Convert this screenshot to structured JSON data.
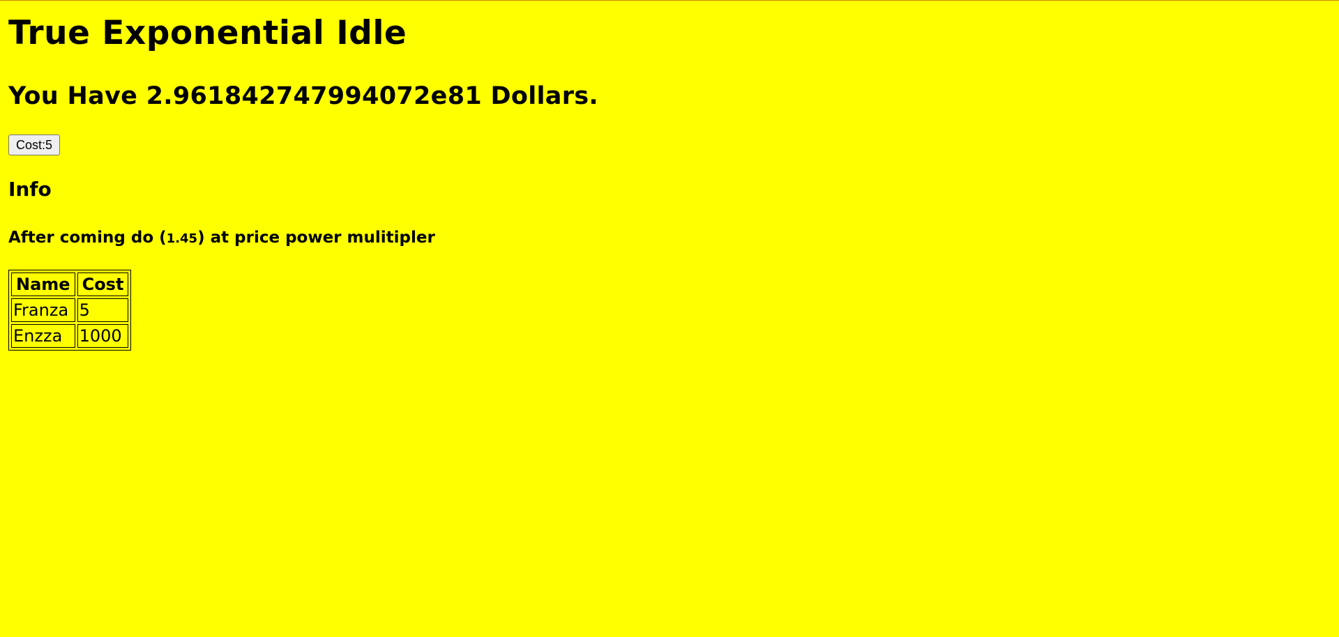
{
  "page": {
    "title": "True Exponential Idle",
    "money_text": "You Have 2.961842747994072e81 Dollars.",
    "background_color": "#ffff00"
  },
  "buy_button": {
    "label": "Cost:5"
  },
  "info": {
    "heading": "Info",
    "text_before": "After coming do (",
    "multiplier": "1.45",
    "text_after": ") at price power mulitipler"
  },
  "table": {
    "headers": [
      "Name",
      "Cost"
    ],
    "rows": [
      {
        "name": "Franza",
        "cost": "5"
      },
      {
        "name": "Enzza",
        "cost": "1000"
      }
    ]
  }
}
